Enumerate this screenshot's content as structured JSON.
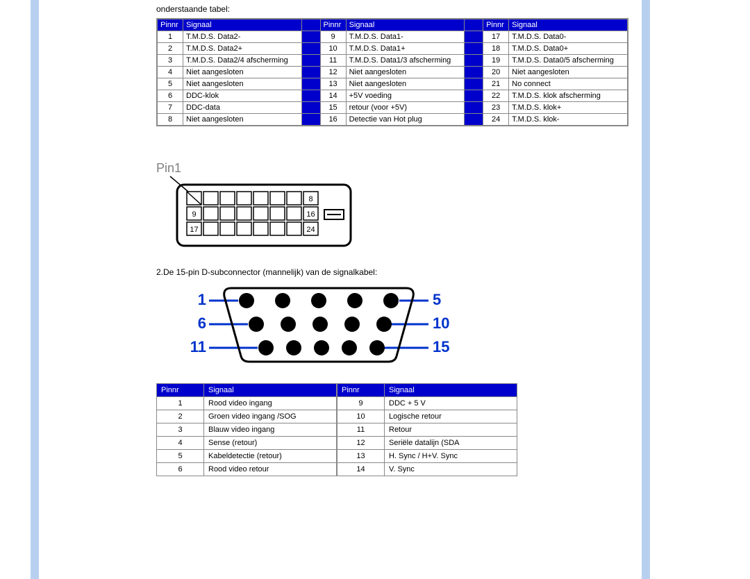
{
  "intro_top": "onderstaande tabel:",
  "headers": {
    "pin": "Pinnr",
    "signal": "Signaal"
  },
  "dvi": {
    "col1": [
      {
        "pin": "1",
        "sig": "T.M.D.S. Data2-"
      },
      {
        "pin": "2",
        "sig": "T.M.D.S. Data2+"
      },
      {
        "pin": "3",
        "sig": "T.M.D.S. Data2/4 afscherming"
      },
      {
        "pin": "4",
        "sig": "Niet aangesloten"
      },
      {
        "pin": "5",
        "sig": "Niet aangesloten"
      },
      {
        "pin": "6",
        "sig": "DDC-klok"
      },
      {
        "pin": "7",
        "sig": "DDC-data"
      },
      {
        "pin": "8",
        "sig": "Niet aangesloten"
      }
    ],
    "col2": [
      {
        "pin": "9",
        "sig": "T.M.D.S. Data1-"
      },
      {
        "pin": "10",
        "sig": "T.M.D.S. Data1+"
      },
      {
        "pin": "11",
        "sig": "T.M.D.S. Data1/3 afscherming"
      },
      {
        "pin": "12",
        "sig": "Niet aangesloten"
      },
      {
        "pin": "13",
        "sig": "Niet aangesloten"
      },
      {
        "pin": "14",
        "sig": "+5V voeding"
      },
      {
        "pin": "15",
        "sig": "retour (voor +5V)"
      },
      {
        "pin": "16",
        "sig": "Detectie van Hot plug"
      }
    ],
    "col3": [
      {
        "pin": "17",
        "sig": "T.M.D.S. Data0-"
      },
      {
        "pin": "18",
        "sig": "T.M.D.S. Data0+"
      },
      {
        "pin": "19",
        "sig": "T.M.D.S. Data0/5 afscherming"
      },
      {
        "pin": "20",
        "sig": "Niet aangesloten"
      },
      {
        "pin": "21",
        "sig": "No connect"
      },
      {
        "pin": "22",
        "sig": "T.M.D.S. klok afscherming"
      },
      {
        "pin": "23",
        "sig": "T.M.D.S. klok+"
      },
      {
        "pin": "24",
        "sig": "T.M.D.S. klok-"
      }
    ]
  },
  "dvi_diagram": {
    "label": "Pin1",
    "corner_nums": {
      "r1": "8",
      "r2l": "9",
      "r2r": "16",
      "r3l": "17",
      "r3r": "24"
    }
  },
  "vga_intro": "2.De 15-pin D-subconnector (mannelijk) van de signalkabel:",
  "vga_diagram": {
    "left": [
      "1",
      "6",
      "11"
    ],
    "right": [
      "5",
      "10",
      "15"
    ]
  },
  "vga": {
    "left": [
      {
        "pin": "1",
        "sig": "Rood video ingang"
      },
      {
        "pin": "2",
        "sig": "Groen video ingang /SOG"
      },
      {
        "pin": "3",
        "sig": "Blauw video ingang"
      },
      {
        "pin": "4",
        "sig": "Sense (retour)"
      },
      {
        "pin": "5",
        "sig": "Kabeldetectie (retour)"
      },
      {
        "pin": "6",
        "sig": "Rood video retour"
      }
    ],
    "right": [
      {
        "pin": "9",
        "sig": "DDC + 5 V"
      },
      {
        "pin": "10",
        "sig": "Logische retour"
      },
      {
        "pin": "11",
        "sig": "Retour"
      },
      {
        "pin": "12",
        "sig": "Seriële datalijn (SDA"
      },
      {
        "pin": "13",
        "sig": "H. Sync / H+V. Sync"
      },
      {
        "pin": "14",
        "sig": "V. Sync"
      }
    ]
  }
}
